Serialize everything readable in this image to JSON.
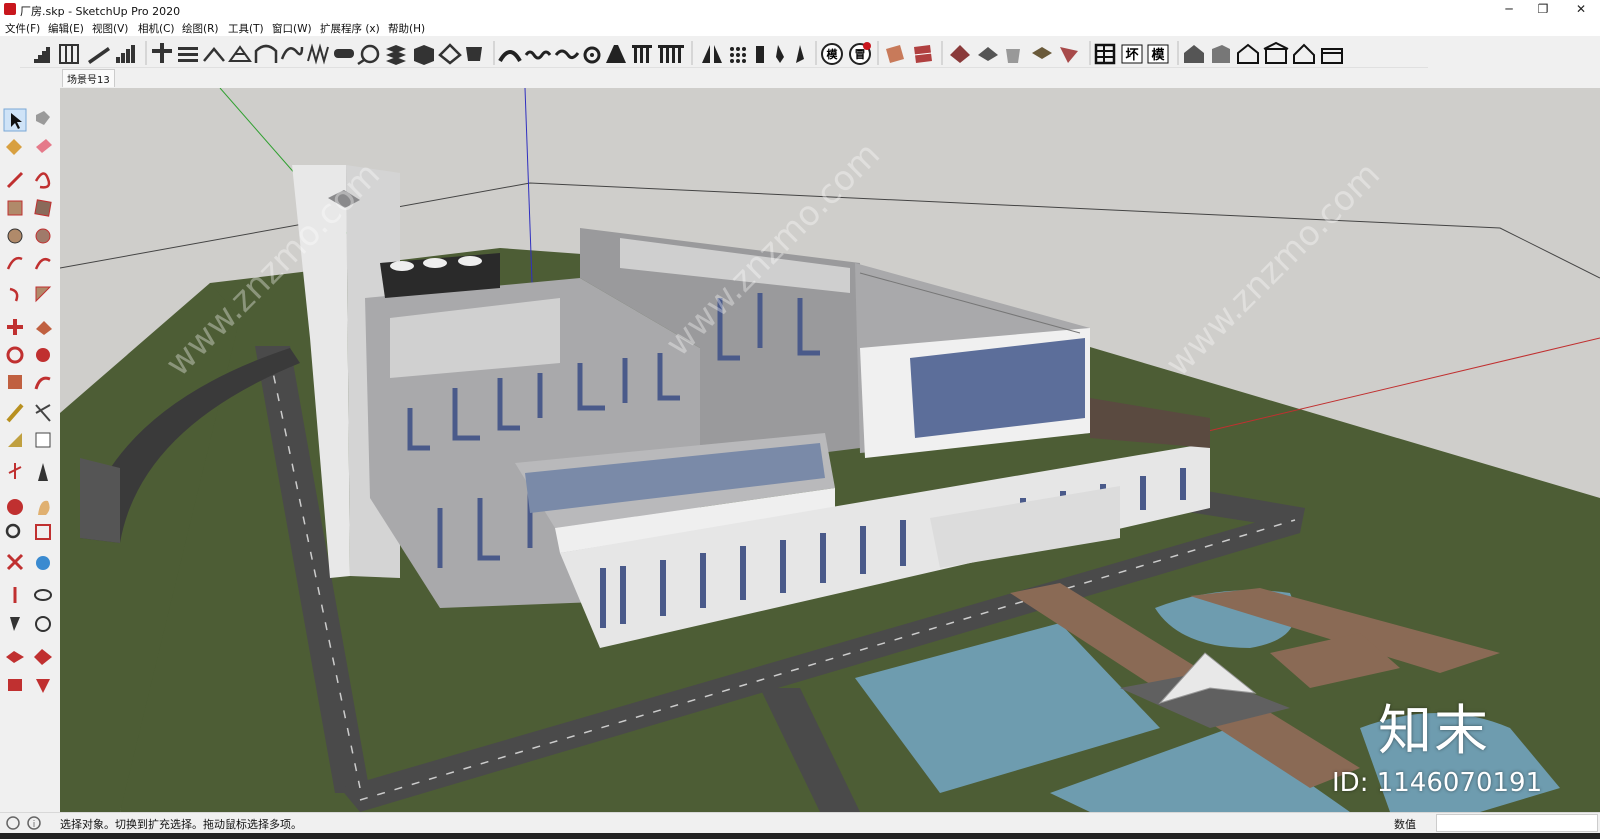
{
  "window": {
    "title": "厂房.skp - SketchUp Pro 2020",
    "controls": {
      "minimize": "─",
      "restore": "❐",
      "close": "✕"
    }
  },
  "menubar": {
    "items": [
      "文件(F)",
      "编辑(E)",
      "视图(V)",
      "相机(C)",
      "绘图(R)",
      "工具(T)",
      "窗口(W)",
      "扩展程序 (x)",
      "帮助(H)"
    ]
  },
  "toolbar": {
    "text_buttons": [
      "模",
      "冒",
      "坏",
      "模"
    ],
    "icons": [
      "stairs-icon",
      "railing-icon",
      "ramp-icon",
      "steps-icon",
      "beam-icon",
      "rebar-icon",
      "roof-icon",
      "truss-icon",
      "arch-icon",
      "curve-icon",
      "spring-icon",
      "pipe-icon",
      "sphere-icon",
      "stack-icon",
      "box-icon",
      "house-tool-icon",
      "arc-icon",
      "wave-icon",
      "spiral-icon",
      "stairs-2-icon",
      "columns-icon",
      "mirror-icon",
      "grid-icon",
      "door-icon",
      "brush-icon",
      "paint-icon",
      "component-icon",
      "plugin-badge-icon",
      "texture-icon",
      "material-icon",
      "terrain-icon",
      "sandbox-icon",
      "cup-icon",
      "tile-icon",
      "shape-icon",
      "table-icon",
      "house-1-icon",
      "house-2-icon",
      "home-icon",
      "shop-icon",
      "roof-house-icon",
      "warehouse-icon"
    ]
  },
  "scene_tab": {
    "label": "场景号13"
  },
  "left_toolbar": {
    "tools": [
      "select-tool",
      "component-tool",
      "paint-bucket-tool",
      "eraser-tool",
      "pencil-tool",
      "freehand-tool",
      "rectangle-tool",
      "rotated-rectangle-tool",
      "circle-tool",
      "polygon-tool",
      "arc-tool",
      "two-point-arc-tool",
      "three-point-arc-tool",
      "pie-tool",
      "move-tool",
      "push-pull-tool",
      "rotate-tool",
      "follow-me-tool",
      "scale-tool",
      "offset-tool",
      "tape-measure-tool",
      "dimension-tool",
      "protractor-tool",
      "text-tool",
      "axes-tool",
      "3d-text-tool",
      "orbit-tool",
      "pan-tool",
      "zoom-tool",
      "zoom-window-tool",
      "zoom-extents-tool",
      "previous-view-tool",
      "position-camera-tool",
      "look-around-tool",
      "walk-tool",
      "section-plane-tool",
      "warehouse-tool",
      "extension-tool",
      "send-tool",
      "ruby-tool"
    ]
  },
  "viewport": {
    "watermark": "www.znzmo.com",
    "brand_logo": "知末",
    "brand_id": "ID: 1146070191"
  },
  "statusbar": {
    "message": "选择对象。切换到扩充选择。拖动鼠标选择多项。",
    "value_label": "数值",
    "value": ""
  },
  "colors": {
    "sky": "#cfcecb",
    "grass": "#4a5a33",
    "road": "#4a4a4a",
    "water": "#6f9eb0",
    "building_grey": "#a9a9ab",
    "facade_blue": "#5c6e9a",
    "brand_red": "#c8161d"
  }
}
